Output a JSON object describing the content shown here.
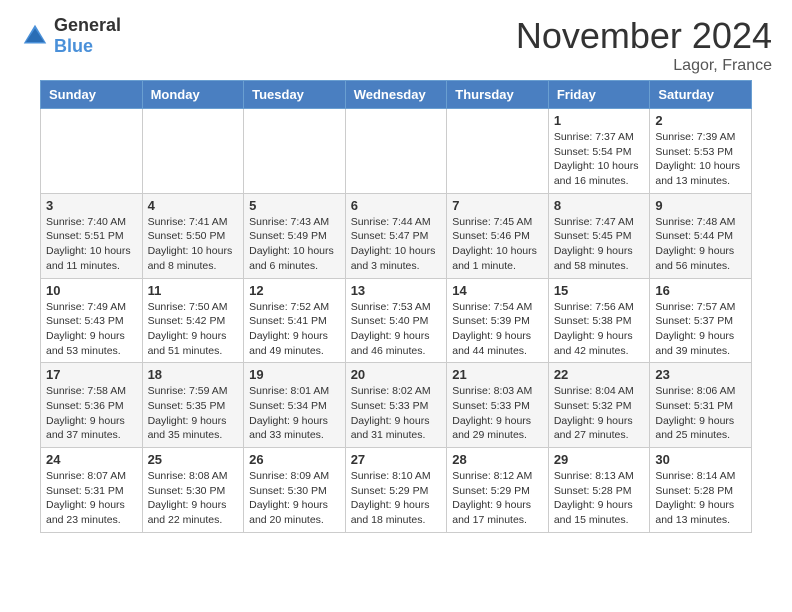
{
  "header": {
    "logo_general": "General",
    "logo_blue": "Blue",
    "month_title": "November 2024",
    "location": "Lagor, France"
  },
  "days_of_week": [
    "Sunday",
    "Monday",
    "Tuesday",
    "Wednesday",
    "Thursday",
    "Friday",
    "Saturday"
  ],
  "weeks": [
    [
      {
        "day": "",
        "info": ""
      },
      {
        "day": "",
        "info": ""
      },
      {
        "day": "",
        "info": ""
      },
      {
        "day": "",
        "info": ""
      },
      {
        "day": "",
        "info": ""
      },
      {
        "day": "1",
        "info": "Sunrise: 7:37 AM\nSunset: 5:54 PM\nDaylight: 10 hours and 16 minutes."
      },
      {
        "day": "2",
        "info": "Sunrise: 7:39 AM\nSunset: 5:53 PM\nDaylight: 10 hours and 13 minutes."
      }
    ],
    [
      {
        "day": "3",
        "info": "Sunrise: 7:40 AM\nSunset: 5:51 PM\nDaylight: 10 hours and 11 minutes."
      },
      {
        "day": "4",
        "info": "Sunrise: 7:41 AM\nSunset: 5:50 PM\nDaylight: 10 hours and 8 minutes."
      },
      {
        "day": "5",
        "info": "Sunrise: 7:43 AM\nSunset: 5:49 PM\nDaylight: 10 hours and 6 minutes."
      },
      {
        "day": "6",
        "info": "Sunrise: 7:44 AM\nSunset: 5:47 PM\nDaylight: 10 hours and 3 minutes."
      },
      {
        "day": "7",
        "info": "Sunrise: 7:45 AM\nSunset: 5:46 PM\nDaylight: 10 hours and 1 minute."
      },
      {
        "day": "8",
        "info": "Sunrise: 7:47 AM\nSunset: 5:45 PM\nDaylight: 9 hours and 58 minutes."
      },
      {
        "day": "9",
        "info": "Sunrise: 7:48 AM\nSunset: 5:44 PM\nDaylight: 9 hours and 56 minutes."
      }
    ],
    [
      {
        "day": "10",
        "info": "Sunrise: 7:49 AM\nSunset: 5:43 PM\nDaylight: 9 hours and 53 minutes."
      },
      {
        "day": "11",
        "info": "Sunrise: 7:50 AM\nSunset: 5:42 PM\nDaylight: 9 hours and 51 minutes."
      },
      {
        "day": "12",
        "info": "Sunrise: 7:52 AM\nSunset: 5:41 PM\nDaylight: 9 hours and 49 minutes."
      },
      {
        "day": "13",
        "info": "Sunrise: 7:53 AM\nSunset: 5:40 PM\nDaylight: 9 hours and 46 minutes."
      },
      {
        "day": "14",
        "info": "Sunrise: 7:54 AM\nSunset: 5:39 PM\nDaylight: 9 hours and 44 minutes."
      },
      {
        "day": "15",
        "info": "Sunrise: 7:56 AM\nSunset: 5:38 PM\nDaylight: 9 hours and 42 minutes."
      },
      {
        "day": "16",
        "info": "Sunrise: 7:57 AM\nSunset: 5:37 PM\nDaylight: 9 hours and 39 minutes."
      }
    ],
    [
      {
        "day": "17",
        "info": "Sunrise: 7:58 AM\nSunset: 5:36 PM\nDaylight: 9 hours and 37 minutes."
      },
      {
        "day": "18",
        "info": "Sunrise: 7:59 AM\nSunset: 5:35 PM\nDaylight: 9 hours and 35 minutes."
      },
      {
        "day": "19",
        "info": "Sunrise: 8:01 AM\nSunset: 5:34 PM\nDaylight: 9 hours and 33 minutes."
      },
      {
        "day": "20",
        "info": "Sunrise: 8:02 AM\nSunset: 5:33 PM\nDaylight: 9 hours and 31 minutes."
      },
      {
        "day": "21",
        "info": "Sunrise: 8:03 AM\nSunset: 5:33 PM\nDaylight: 9 hours and 29 minutes."
      },
      {
        "day": "22",
        "info": "Sunrise: 8:04 AM\nSunset: 5:32 PM\nDaylight: 9 hours and 27 minutes."
      },
      {
        "day": "23",
        "info": "Sunrise: 8:06 AM\nSunset: 5:31 PM\nDaylight: 9 hours and 25 minutes."
      }
    ],
    [
      {
        "day": "24",
        "info": "Sunrise: 8:07 AM\nSunset: 5:31 PM\nDaylight: 9 hours and 23 minutes."
      },
      {
        "day": "25",
        "info": "Sunrise: 8:08 AM\nSunset: 5:30 PM\nDaylight: 9 hours and 22 minutes."
      },
      {
        "day": "26",
        "info": "Sunrise: 8:09 AM\nSunset: 5:30 PM\nDaylight: 9 hours and 20 minutes."
      },
      {
        "day": "27",
        "info": "Sunrise: 8:10 AM\nSunset: 5:29 PM\nDaylight: 9 hours and 18 minutes."
      },
      {
        "day": "28",
        "info": "Sunrise: 8:12 AM\nSunset: 5:29 PM\nDaylight: 9 hours and 17 minutes."
      },
      {
        "day": "29",
        "info": "Sunrise: 8:13 AM\nSunset: 5:28 PM\nDaylight: 9 hours and 15 minutes."
      },
      {
        "day": "30",
        "info": "Sunrise: 8:14 AM\nSunset: 5:28 PM\nDaylight: 9 hours and 13 minutes."
      }
    ]
  ]
}
